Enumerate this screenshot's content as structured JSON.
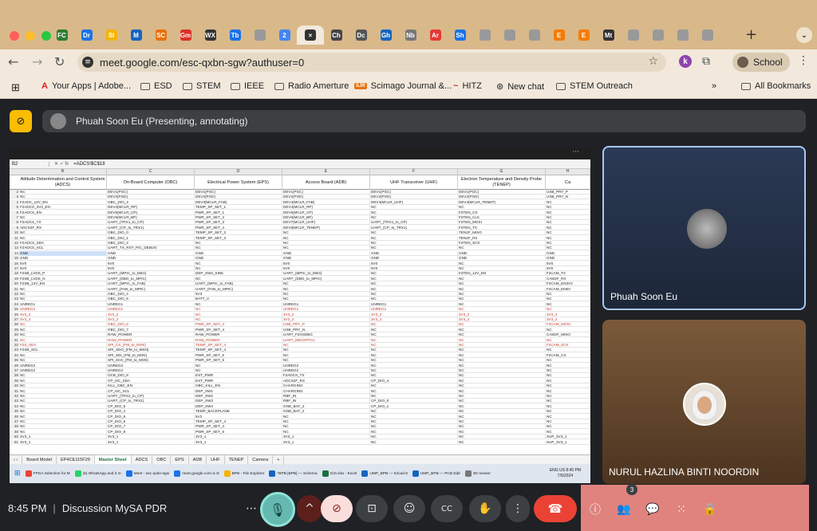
{
  "browser": {
    "url": "meet.google.com/esc-qxbn-sgw?authuser=0",
    "profile_label": "School",
    "extension_badge": "k",
    "tab_favicons": [
      "FC",
      "Dr",
      "Sl",
      "M",
      "SC",
      "Gm",
      "WX",
      "Tb",
      "",
      "2",
      "×",
      "Ch",
      "Dc",
      "Gh",
      "Nb",
      "Ar",
      "Sh",
      "",
      "",
      "",
      "E",
      "E",
      "Mt",
      "",
      "",
      "",
      ""
    ],
    "tab_colors": [
      "#2e7d32",
      "#1a73e8",
      "#f4b400",
      "#1565c0",
      "#e8710a",
      "#d93025",
      "#333",
      "#1a73e8",
      "#999",
      "#4285f4",
      "#333",
      "#444",
      "#555",
      "#1565c0",
      "#777",
      "#e53935",
      "#1a73e8",
      "#999",
      "#999",
      "#999",
      "#f57c00",
      "#f57c00",
      "#333",
      "#999",
      "#999",
      "#999",
      "#999"
    ]
  },
  "bookmarks": [
    {
      "label": "Your Apps | Adobe...",
      "icon": "adobe-icon"
    },
    {
      "label": "ESD",
      "icon": "folder-icon"
    },
    {
      "label": "STEM",
      "icon": "folder-icon"
    },
    {
      "label": "IEEE",
      "icon": "folder-icon"
    },
    {
      "label": "Radio Amerture",
      "icon": "folder-icon"
    },
    {
      "label": "Scimago Journal &...",
      "icon": "sjr-icon"
    },
    {
      "label": "HITZ",
      "icon": "hitz-icon"
    },
    {
      "label": "New chat",
      "icon": "openai-icon"
    },
    {
      "label": "STEM Outreach",
      "icon": "folder-icon"
    }
  ],
  "all_bookmarks": "All Bookmarks",
  "presenter_bar": "Phuah Soon Eu (Presenting, annotating)",
  "sheet": {
    "cell_ref": "B2",
    "formula": "=ADCS!$C$18",
    "columns": [
      "B",
      "C",
      "D",
      "E",
      "F",
      "G",
      "H"
    ],
    "headers": [
      "Attitude Determination and Control System (ADCS)",
      "On-Board Computer (OBC)",
      "Electrical Power System (EPS)",
      "Access Board (ADB)",
      "UHF Transceiver (UHF)",
      "Electron Temperature and Density Probe (TENEP)",
      "Ca"
    ],
    "rows": [
      [
        "NC",
        "DEV1(PGC)",
        "DEV1(PGC)",
        "DEV1(PGC)",
        "DEV1(PGC)",
        "DEV1(PGC)",
        "USB_PRY_P"
      ],
      [
        "NC",
        "DEV2(PGD)",
        "DEV2(PGD)",
        "DEV2(PGD)",
        "DEV2(PGD)",
        "DEV2(PGD)",
        "USB_PRY_N"
      ],
      [
        "F2ADC_12V_EN",
        "OBC_DIO_3",
        "DEV3(MCLR_FAB)",
        "DEV4(MCLR_FAB)",
        "DEV4(MCLR_UHF)",
        "DEV4(MCLR_TENEP)",
        "NC"
      ],
      [
        "F2ADCS_3V3_EN",
        "DEV4(MCLR_RP)",
        "TEMP_SP_SET_1",
        "DEV4(MCLR_RP)",
        "NC",
        "NC",
        "NC"
      ],
      [
        "F2ADCS_EN",
        "DEV5(MCLR_CP)",
        "PWR_SP_SET_1",
        "DEV5(MCLR_CP)",
        "NC",
        "F2TEN_CS",
        "NC"
      ],
      [
        "NC",
        "DEV6(MCLR_BP)",
        "PWR_SP_SET_2",
        "DEV6(MCLR_BP)",
        "NC",
        "F2TEN_CLK",
        "NC"
      ],
      [
        "F2ADCS_TX",
        "UART_(TRX1_to_CP)",
        "PWR_SP_SET_3",
        "DEV7(MCLR_UHF)",
        "UART_(TRX1_to_CP)",
        "F2TEN_MOSI",
        "NC"
      ],
      [
        "ADCS2F_RX",
        "UART_(CP_to_TRX1)",
        "PWR_SP_SET_4",
        "DEV8(MCLR_TENEP)",
        "UART_(CP_to_TRX1)",
        "F2TEN_TX",
        "NC"
      ],
      [
        "NC",
        "OBC_DIO_0",
        "TEMP_SP_SET_2",
        "NC",
        "NC",
        "TEN2F_MISO",
        "NC"
      ],
      [
        "NC",
        "OBC_DIO_1",
        "TEMP_SP_SET_3",
        "NC",
        "NC",
        "TEN2F_RX",
        "NC"
      ],
      [
        "F2ADCS_SDA",
        "OBC_DIO_2",
        "NC",
        "NC",
        "NC",
        "F2TEN_SCK",
        "NC"
      ],
      [
        "F2ADCS_SCL",
        "UART_TX_RST_PIC_DEBUG",
        "NC",
        "NC",
        "NC",
        "NC",
        "NC"
      ],
      [
        "GND",
        "GND",
        "GND",
        "GND",
        "GND",
        "GND",
        "GND"
      ],
      [
        "GND",
        "GND",
        "GND",
        "GND",
        "GND",
        "GND",
        "GND"
      ],
      [
        "5V0",
        "5V0",
        "NC",
        "5V0",
        "5V0",
        "NC",
        "5V0"
      ],
      [
        "5V0",
        "5V0",
        "NC",
        "5V0",
        "5V0",
        "NC",
        "5V0"
      ],
      [
        "F2SB_LVDS_P",
        "UART_(MPIC_to_DBG)",
        "DEP_SW2_SINK",
        "UART_(MPIC_to_DBG)",
        "NC",
        "F2TEN_12V_EN",
        "F2CAM_TX"
      ],
      [
        "F2SB_LVDS_N",
        "UART_(DBG_to_MPIC)",
        "NC",
        "UART_(DBG_to_MPIC)",
        "NC",
        "NC",
        "CAM2F_RX"
      ],
      [
        "F2SB_12V_EN",
        "UART_(MPIC_to_FAB)",
        "UART_(MPIC_to_FAB)",
        "NC",
        "NC",
        "NC",
        "F2CAM_EN3V3"
      ],
      [
        "NC",
        "UART_(FAB_to_MPIC)",
        "UART_(FAB_to_MPIC)",
        "NC",
        "NC",
        "NC",
        "F2CAM_EN5V"
      ],
      [
        "NC",
        "OBC_DIO_4",
        "5V3",
        "NC",
        "NC",
        "NC",
        "NC"
      ],
      [
        "NC",
        "OBC_DIO_5",
        "BATT_V",
        "NC",
        "NC",
        "NC",
        "NC"
      ],
      [
        "UNREG1",
        "UNREG1",
        "NC",
        "UNREG1",
        "UNREG1",
        "NC",
        "NC"
      ],
      [
        "UNREG1",
        "UNREG1",
        "NC",
        "UNREG1",
        "UNREG1",
        "NC",
        "NC"
      ],
      [
        "3V3_2",
        "3V3_2",
        "NC",
        "3V3_2",
        "3V3_2",
        "3V3_2",
        "3V3_2"
      ],
      [
        "3V3_2",
        "3V3_2",
        "NC",
        "3V3_2",
        "3V3_2",
        "3V3_2",
        "3V3_2"
      ],
      [
        "NC",
        "OBC_DIO_6",
        "PWR_SP_SET_4",
        "USB_PRY_P",
        "NC",
        "NC",
        "F2CAM_MOSI"
      ],
      [
        "NC",
        "OBC_DIO_7",
        "PWR_SP_SET_4",
        "USB_PRY_N",
        "NC",
        "NC",
        "NC"
      ],
      [
        "NC",
        "RAW_POWER",
        "RAW_POWER",
        "UART_F2GSDBG",
        "NC",
        "NC",
        "CAM2F_MISO"
      ],
      [
        "NC",
        "RAW_POWER",
        "RAW_POWER",
        "UART_DBG2FPGA",
        "NC",
        "NC",
        "NC"
      ],
      [
        "F2S_SDA",
        "SPI_CS_(FM_to_MSN)",
        "TEMP_SP_SET_4",
        "NC",
        "NC",
        "NC",
        "F2CAM_SCK"
      ],
      [
        "F2SB_SCL",
        "SPI_SDO_(FM_to_MSN)",
        "TEMP_SP_SET_4",
        "NC",
        "NC",
        "NC",
        "NC"
      ],
      [
        "NC",
        "SPI_SDI_(FM_to_MSN)",
        "PWR_SP_SET_5",
        "NC",
        "NC",
        "NC",
        "F2CAM_CS"
      ],
      [
        "NC",
        "SPI_SCK_(FM_to_MSN)",
        "PWR_SP_SET_5",
        "NC",
        "NC",
        "NC",
        "NC"
      ],
      [
        "UNREG2",
        "UNREG2",
        "NC",
        "UNREG2",
        "NC",
        "NC",
        "NC"
      ],
      [
        "UNREG2",
        "UNREG2",
        "NC",
        "UNREG2",
        "NC",
        "NC",
        "NC"
      ],
      [
        "NC",
        "OCB_DIO_8",
        "EXT_PWR",
        "F2ADCS_TX",
        "NC",
        "NC",
        "NC"
      ],
      [
        "NC",
        "CP_I2C_SDA",
        "EXT_PWR",
        "ADCS2F_RX",
        "CP_DIO_4",
        "NC",
        "NC"
      ],
      [
        "NC",
        "KILL_OBC_EN",
        "OBC_KILL_EN",
        "CHARGING",
        "NC",
        "NC",
        "NC"
      ],
      [
        "NC",
        "CP_I2C_SCL",
        "DEP_SW1",
        "CHARGING",
        "NC",
        "NC",
        "NC"
      ],
      [
        "NC",
        "UART_(TRX2_to_CP)",
        "DEP_SW2",
        "RBF_IN",
        "NC",
        "NC",
        "NC"
      ],
      [
        "NC",
        "UART_(CP_to_TRX2)",
        "DEP_SW3",
        "RBF_IN",
        "CP_DIO_0",
        "NC",
        "NC"
      ],
      [
        "NC",
        "CP_DIO_5",
        "DEP_SW4",
        "GND_BAT_2",
        "CP_DIO_1",
        "NC",
        "NC"
      ],
      [
        "NC",
        "CP_DIO_4",
        "TEMP_BACKPLANE",
        "GND_BAT_2",
        "NC",
        "NC",
        "NC"
      ],
      [
        "NC",
        "CP_DIO_5",
        "5V3",
        "NC",
        "NC",
        "NC",
        "NC"
      ],
      [
        "NC",
        "CP_DIO_6",
        "TEMP_SP_SET_4",
        "NC",
        "NC",
        "NC",
        "NC"
      ],
      [
        "NC",
        "CP_DIO_7",
        "PWR_SP_SET_4",
        "NC",
        "NC",
        "NC",
        "NC"
      ],
      [
        "NC",
        "CP_DIO_8",
        "PWR_SP_SET_6",
        "NC",
        "NC",
        "NC",
        "NC"
      ],
      [
        "3V3_1",
        "3V3_1",
        "3V3_1",
        "3V3_1",
        "NC",
        "NC",
        "SUP_3V3_1"
      ],
      [
        "3V3_1",
        "3V3_1",
        "3V3_1",
        "3V3_1",
        "NC",
        "NC",
        "SUP_3V3_1"
      ]
    ],
    "red_rows": [
      23,
      24,
      25,
      26,
      29,
      30
    ],
    "selected_row": 12,
    "sheet_tabs": [
      "Board Model",
      "EP4CE115F29",
      "Master Sheet",
      "ADCS",
      "OBC",
      "EPS",
      "ADB",
      "UHF",
      "TENEP",
      "Camera"
    ],
    "active_sheet": "Master Sheet",
    "taskbar_items": [
      "FPGA Selection for M",
      "(5) WhatsApp and 3 m",
      "Meet - esc-qxbn-sgw",
      "meet.google.com is sl",
      "BPB - File Explorer",
      "*BPB [BPB] — Schema",
      "ICD.xlsx - Excel",
      "UMP_BPB — KiCad 8",
      "UMP_BPB — PCB Edit",
      "3D Viewer"
    ],
    "lang": "ENG US",
    "time": "8:45 PM",
    "date": "7/5/2024"
  },
  "participants": [
    {
      "name": "Phuah Soon Eu"
    },
    {
      "name": "NURUL HAZLINA BINTI NOORDIN"
    }
  ],
  "meeting": {
    "time": "8:45 PM",
    "separator": "|",
    "title": "Discussion MySA PDR",
    "people_count": "3"
  }
}
